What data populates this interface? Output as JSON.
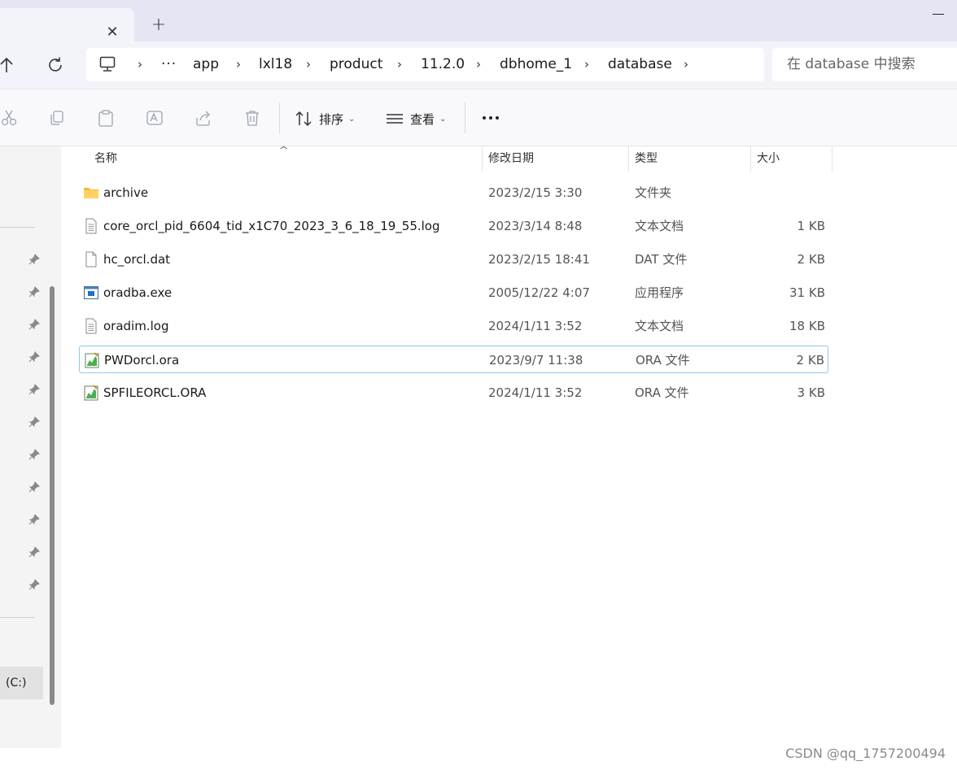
{
  "tab": {
    "close_symbol": "✕",
    "new_symbol": "+"
  },
  "breadcrumb": {
    "overflow": "···",
    "items": [
      "app",
      "lxl18",
      "product",
      "11.2.0",
      "dbhome_1",
      "database"
    ],
    "separator": "›"
  },
  "search": {
    "placeholder": "在 database 中搜索"
  },
  "toolbar": {
    "sort_label": "排序",
    "view_label": "查看",
    "more_symbol": "···"
  },
  "columns": {
    "name": "名称",
    "date": "修改日期",
    "type": "类型",
    "size": "大小"
  },
  "files": [
    {
      "name": "archive",
      "date": "2023/2/15 3:30",
      "type": "文件夹",
      "size": "",
      "icon": "folder-icon"
    },
    {
      "name": "core_orcl_pid_6604_tid_x1C70_2023_3_6_18_19_55.log",
      "date": "2023/3/14 8:48",
      "type": "文本文档",
      "size": "1 KB",
      "icon": "text-file-icon"
    },
    {
      "name": "hc_orcl.dat",
      "date": "2023/2/15 18:41",
      "type": "DAT 文件",
      "size": "2 KB",
      "icon": "blank-file-icon"
    },
    {
      "name": "oradba.exe",
      "date": "2005/12/22 4:07",
      "type": "应用程序",
      "size": "31 KB",
      "icon": "exe-file-icon"
    },
    {
      "name": "oradim.log",
      "date": "2024/1/11 3:52",
      "type": "文本文档",
      "size": "18 KB",
      "icon": "text-file-icon"
    },
    {
      "name": "PWDorcl.ora",
      "date": "2023/9/7 11:38",
      "type": "ORA 文件",
      "size": "2 KB",
      "icon": "ora-file-icon"
    },
    {
      "name": "SPFILEORCL.ORA",
      "date": "2024/1/11 3:52",
      "type": "ORA 文件",
      "size": "3 KB",
      "icon": "ora-file-icon"
    }
  ],
  "selected_file": "PWDorcl.ora",
  "nav": {
    "drive_label": "(C:)"
  },
  "watermark": "CSDN @qq_1757200494",
  "colors": {
    "tabstrip": "#e4e7f3",
    "selection_border": "#8fc7e8",
    "accent": "#0067c0"
  }
}
